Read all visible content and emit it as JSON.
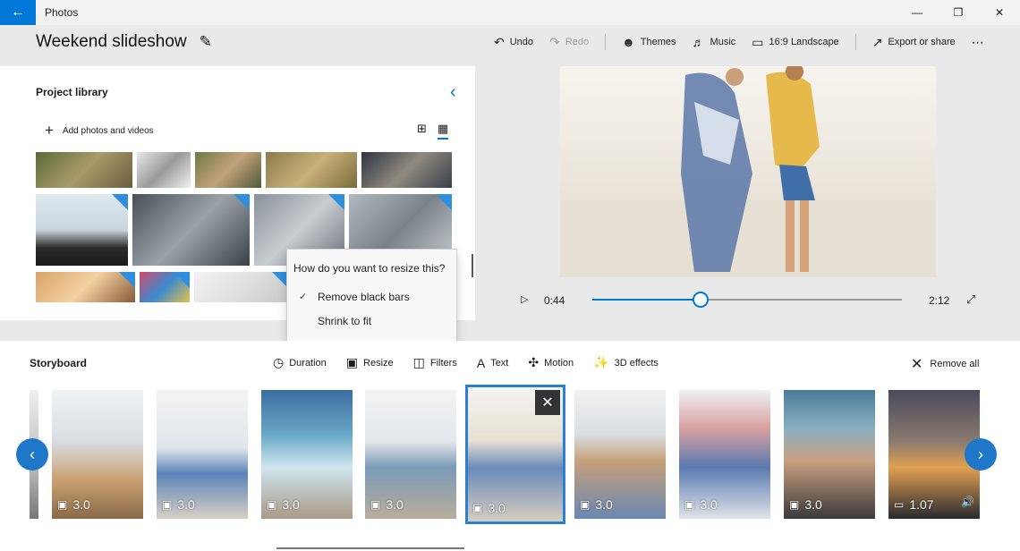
{
  "app": {
    "title": "Photos"
  },
  "project": {
    "title": "Weekend slideshow"
  },
  "toolbar": {
    "undo": "Undo",
    "redo": "Redo",
    "themes": "Themes",
    "music": "Music",
    "aspect": "16:9 Landscape",
    "export": "Export or share"
  },
  "library": {
    "title": "Project library",
    "add_label": "Add photos and videos"
  },
  "flyout": {
    "question": "How do you want to resize this?",
    "options": [
      "Remove black bars",
      "Shrink to fit"
    ],
    "selected": "Remove black bars"
  },
  "player": {
    "current_time": "0:44",
    "total_time": "2:12",
    "progress": 0.35
  },
  "storyboard": {
    "title": "Storyboard",
    "tools": [
      "Duration",
      "Resize",
      "Filters",
      "Text",
      "Motion",
      "3D effects"
    ],
    "remove_all": "Remove all",
    "cards": [
      {
        "duration": "3.0"
      },
      {
        "duration": "3.0"
      },
      {
        "duration": "3.0"
      },
      {
        "duration": "3.0"
      },
      {
        "duration": "3.0",
        "selected": true
      },
      {
        "duration": "3.0"
      },
      {
        "duration": "3.0"
      },
      {
        "duration": "3.0"
      },
      {
        "duration": "1.07",
        "video": true
      }
    ]
  },
  "colors": {
    "accent": "#0078d7",
    "nav": "#1f77c9"
  }
}
